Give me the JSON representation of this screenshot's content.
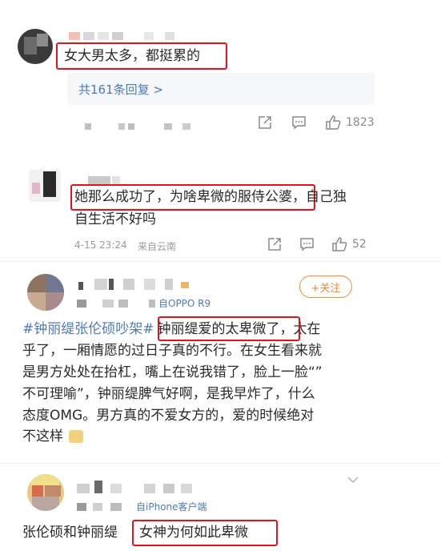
{
  "comment1": {
    "text": "女大男太多，都挺累的",
    "replies_link": "共161条回复 >",
    "like_count": "1823"
  },
  "comment2": {
    "text_line1": "她那么成功了，为啥卑微的服侍公婆，自己独",
    "text_line2": "自生活不好吗",
    "timestamp": "4-15 23:24",
    "source": "来自云南",
    "like_count": "52"
  },
  "post3": {
    "device": "自OPPO R9",
    "follow_label": "+关注",
    "topic": "#钟丽缇张伦硕吵架#",
    "highlight": "钟丽缇爱的太卑微了",
    "line1_rest": "，太在",
    "line2": "乎了，一厢情愿的过日子真的不行。在女生看来就",
    "line3": "是男方处处在抬杠，嘴上在说我错了，脸上一脸“”",
    "line4": "不可理喻”，钟丽缇脾气好啊，是我早炸了，什么",
    "line5": "态度OMG。男方真的不爱女方的，爱的时候绝对",
    "line6": "不这样"
  },
  "post4": {
    "device": "自iPhone客户端",
    "text_plain": "张伦硕和钟丽缇",
    "text_highlight": "女神为何如此卑微"
  },
  "colors": {
    "highlight_box": "#e0141b",
    "link": "#4e7bb7",
    "follow": "#f08a3a"
  }
}
